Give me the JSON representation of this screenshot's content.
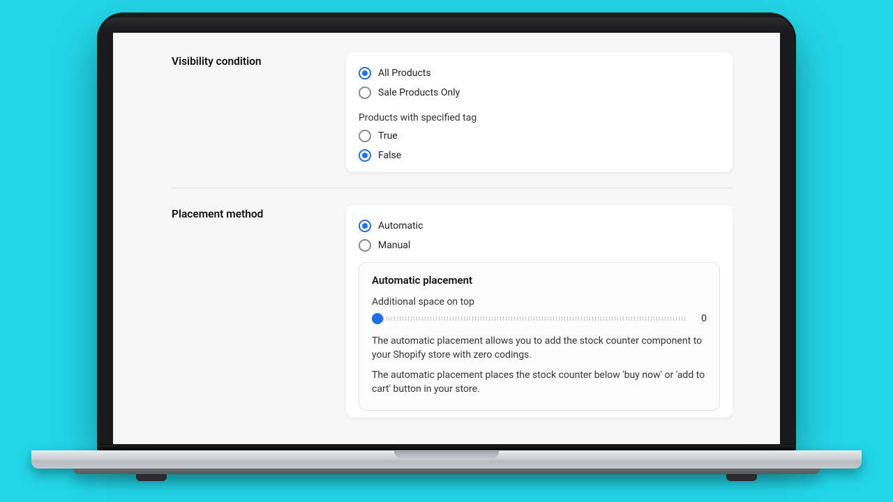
{
  "visibility": {
    "title": "Visibility condition",
    "options": {
      "all_products": "All Products",
      "sale_products_only": "Sale Products Only"
    },
    "tag_heading": "Products with specified tag",
    "tag_options": {
      "true_label": "True",
      "false_label": "False"
    }
  },
  "placement": {
    "title": "Placement method",
    "options": {
      "automatic": "Automatic",
      "manual": "Manual"
    },
    "auto": {
      "heading": "Automatic placement",
      "space_label": "Additional space on top",
      "space_value": "0",
      "desc1": "The automatic placement allows you to add the stock counter component to your Shopify store with zero codings.",
      "desc2": "The automatic placement places the stock counter below 'buy now' or 'add to cart' button in your store."
    }
  }
}
